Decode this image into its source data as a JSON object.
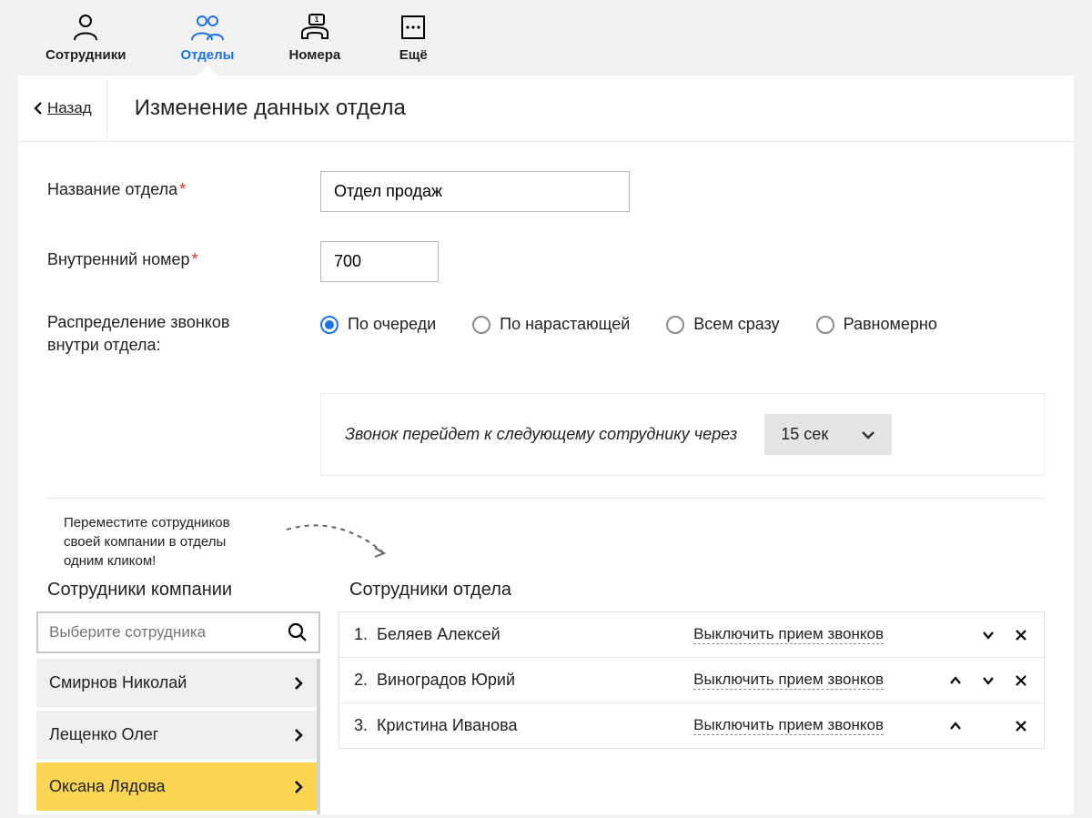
{
  "tabs": {
    "employees": "Сотрудники",
    "departments": "Отделы",
    "numbers": "Номера",
    "more": "Ещё"
  },
  "header": {
    "back": "Назад",
    "title": "Изменение данных отдела"
  },
  "form": {
    "name_label": "Название отдела",
    "name_value": "Отдел продаж",
    "ext_label": "Внутренний номер",
    "ext_value": "700",
    "dist_label_line1": "Распределение звонков",
    "dist_label_line2": "внутри отдела:",
    "dist_options": {
      "queue": "По очереди",
      "rising": "По нарастающей",
      "all": "Всем сразу",
      "even": "Равномерно"
    },
    "sub_text": "Звонок перейдет к следующему сотруднику через",
    "sub_select": "15 сек"
  },
  "hint": "Переместите сотрудников своей компании в отделы одним кликом!",
  "left": {
    "heading": "Сотрудники компании",
    "search_placeholder": "Выберите сотрудника",
    "items": [
      "Смирнов Николай",
      "Лещенко Олег",
      "Оксана Лядова"
    ]
  },
  "right": {
    "heading": "Сотрудники отдела",
    "toggle_label": "Выключить прием звонков",
    "items": [
      {
        "idx": "1.",
        "name": "Беляев Алексей",
        "up": false,
        "down": true
      },
      {
        "idx": "2.",
        "name": "Виноградов Юрий",
        "up": true,
        "down": true
      },
      {
        "idx": "3.",
        "name": "Кристина Иванова",
        "up": true,
        "down": false
      }
    ]
  }
}
